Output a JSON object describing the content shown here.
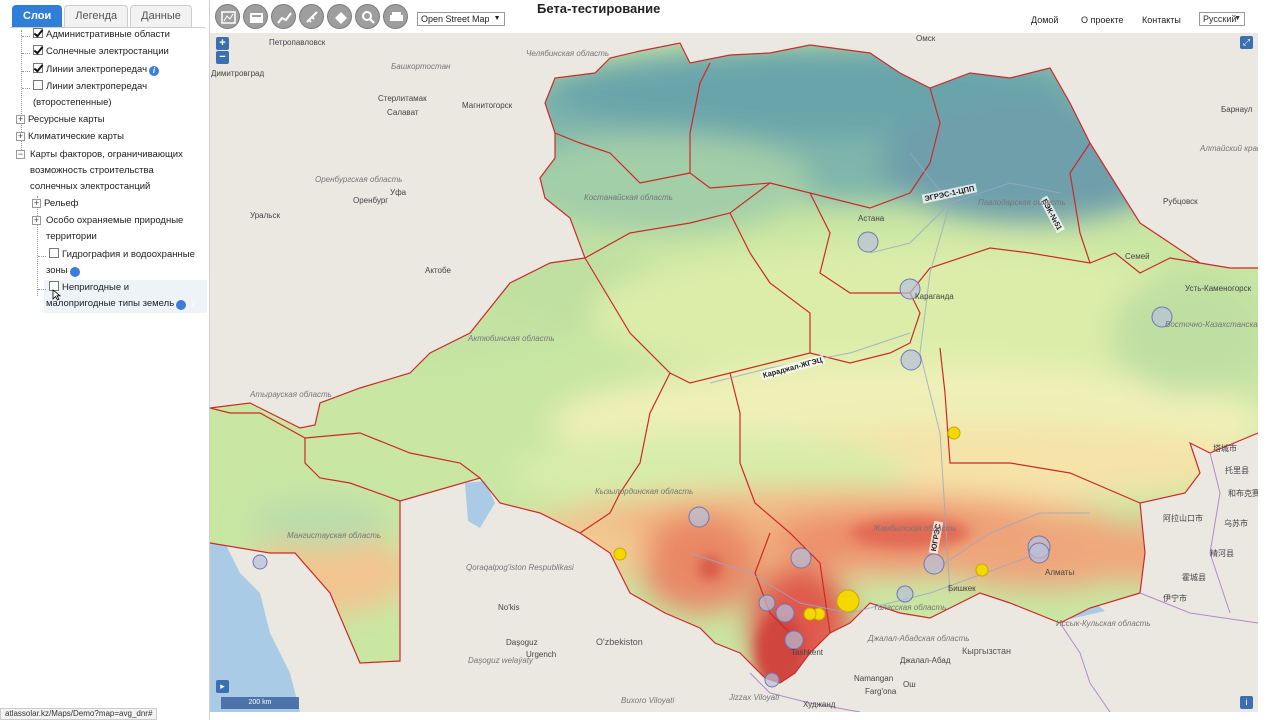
{
  "tabs": [
    {
      "label": "Слои",
      "active": true
    },
    {
      "label": "Легенда",
      "active": false
    },
    {
      "label": "Данные",
      "active": false
    }
  ],
  "tree": {
    "admin": "Административные области",
    "solar": "Солнечные электростанции",
    "lines": "Линии электропередач",
    "lines2": "Линии электропередач (второстепенные)",
    "resource": "Ресурсные карты",
    "climate": "Климатические карты",
    "factors": "Карты факторов, ограничивающих возможность строительства солнечных электростанций",
    "relief": "Рельеф",
    "protected": "Особо охраняемые природные территории",
    "hydro": "Гидрография и водоохранные зоны",
    "unsuitable": "Непригодные и малопригодные типы земель"
  },
  "header": {
    "basemap": "Open Street Map",
    "title": "Бета-тестирование",
    "nav": [
      "Домой",
      "О проекте",
      "Контакты"
    ],
    "language": "Русский"
  },
  "map": {
    "zoom_in": "+",
    "zoom_out": "−",
    "scale": "200 km",
    "routes": [
      "ЭГРЭС-1-ЦПП",
      "ЕЭК-№51",
      "Караджал-ЖГЭЦ",
      "ЮГРЭС"
    ],
    "labels": {
      "petropavlovsk": "Петропавловск",
      "omsk": "Омск",
      "chelyabinsk": "Челябинская область",
      "bashkortostan": "Башкортостан",
      "dimitrovgrad": "Димитровград",
      "sterlitamak": "Стерлитамак",
      "salavat": "Салават",
      "magnitogorsk": "Магнитогорск",
      "ufa": "Уфа",
      "orenburg_obl": "Оренбургская область",
      "orenburg": "Оренбург",
      "barnaul": "Барнаул",
      "altai": "Алтайский край",
      "rubtsovsk": "Рубцовск",
      "kostanay": "Костанайская область",
      "pavlodar": "Павлодарская область",
      "astana": "Астана",
      "karaganda": "Караганда",
      "semey": "Семей",
      "ust": "Усть-Каменогорск",
      "vko": "Восточно-Казахстанская область",
      "aktobe": "Актобе",
      "aktobe_obl": "Актюбинская область",
      "uralsk": "Уральск",
      "atyrau": "Атырауская область",
      "mangystau": "Мангистауская область",
      "kyzylorda": "Кызылординская область",
      "zhambyl": "Жамбылская область",
      "almaty": "Алматы",
      "taraz": "Таласская область",
      "zhalal": "Джалал-Абадская область",
      "kyrgyz": "Кыргызстан",
      "issyk": "Иссык-Кульская область",
      "uzbekistan": "O'zbekiston",
      "karakalpak": "Qoraqalpog'iston Respublikasi",
      "urgench": "Urgench",
      "nukus": "No'kis",
      "dashoguz": "Daşoguz",
      "dashoguz_w": "Daşoguz welaýaty",
      "tashkent": "Tashkent",
      "namangan": "Namangan",
      "fergana": "Farg'ona",
      "osh": "Ош",
      "jalalabad": "Джалал-Абад",
      "bishkek": "Бишкек",
      "bukhara": "Buxoro Viloyati",
      "jizzakh": "Jizzax Viloyati",
      "khujand": "Худжанд",
      "xinjiang1": "托里县",
      "xinjiang2": "塔城市",
      "xinjiang3": "霍城县",
      "xinjiang4": "伊宁市",
      "xinjiang5": "精河县",
      "xinjiang6": "和布克赛尔",
      "xinjiang7": "乌苏市",
      "xinjiang8": "阿拉山口市"
    }
  },
  "footer": {
    "url": "atlassolar.kz/Maps/Demo?map=avg_dnr#"
  },
  "colors": {
    "accent": "#2f7fd8",
    "border": "#cc2a2a",
    "station": "#f5d800",
    "station_big": "#b0b8d8"
  }
}
